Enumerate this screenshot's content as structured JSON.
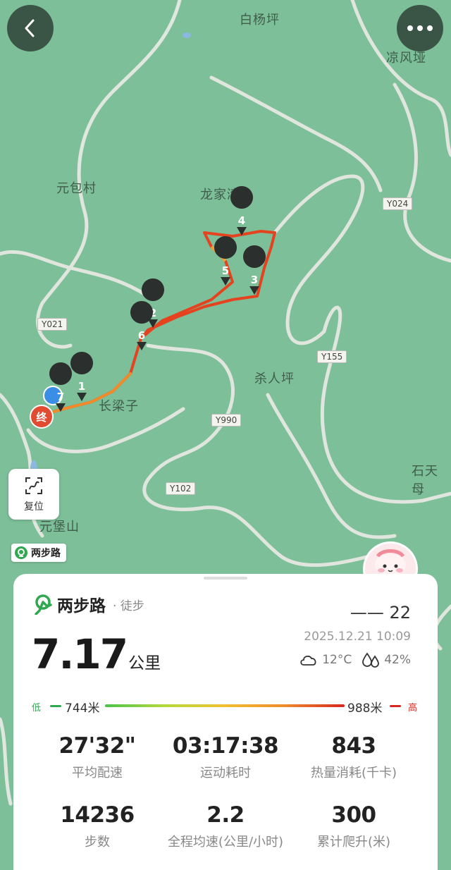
{
  "map": {
    "place_labels": [
      {
        "text": "白杨坪",
        "id": "baiyangping"
      },
      {
        "text": "凉风垭",
        "id": "liangfengya"
      },
      {
        "text": "元包村",
        "id": "yuanbaocun"
      },
      {
        "text": "龙家湾",
        "id": "longjiawan"
      },
      {
        "text": "杀人坪",
        "id": "sharenping"
      },
      {
        "text": "长梁子",
        "id": "changliangzi"
      },
      {
        "text": "石天母",
        "id": "shitianmu"
      },
      {
        "text": "元堡山",
        "id": "yuanbaoshan"
      }
    ],
    "road_tags": [
      "Y024",
      "Y021",
      "Y155",
      "Y990",
      "Y102"
    ],
    "markers": [
      "1",
      "2",
      "3",
      "4",
      "5",
      "6",
      "7"
    ],
    "end_marker": "终",
    "reset_label": "复位",
    "brand_tag": "两步路"
  },
  "colors": {
    "map_bg": "#7dbf98",
    "road": "#e9ece6",
    "track_start": "#f08a2a",
    "track_end": "#d6281e",
    "accent": "#2fa84f"
  },
  "card": {
    "brand": "两步路",
    "activity": "· 徒步",
    "user_name": "—— 22",
    "date": "2025.12.21 10:09",
    "distance_value": "7.17",
    "distance_unit": "公里",
    "temperature": "12°C",
    "humidity": "42%",
    "elevation": {
      "low_label": "低",
      "low": "744米",
      "high": "988米",
      "high_label": "高"
    },
    "stats": [
      {
        "value": "27'32\"",
        "label": "平均配速"
      },
      {
        "value": "03:17:38",
        "label": "运动耗时"
      },
      {
        "value": "843",
        "label": "热量消耗(千卡)"
      },
      {
        "value": "14236",
        "label": "步数"
      },
      {
        "value": "2.2",
        "label": "全程均速(公里/小时)"
      },
      {
        "value": "300",
        "label": "累计爬升(米)"
      }
    ]
  }
}
